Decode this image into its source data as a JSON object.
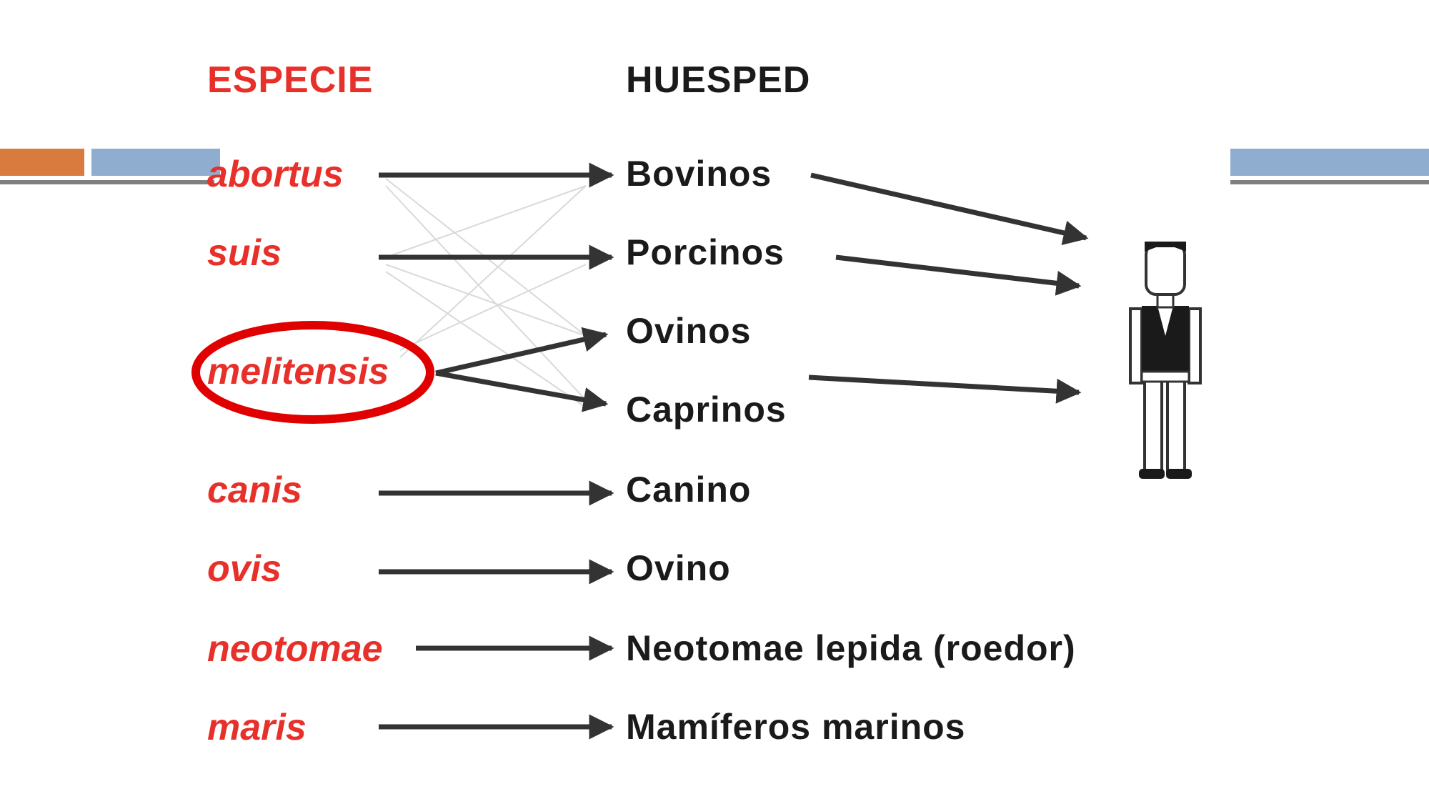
{
  "headers": {
    "species": "ESPECIE",
    "host": "HUESPED"
  },
  "species": [
    "abortus",
    "suis",
    "melitensis",
    "canis",
    "ovis",
    "neotomae",
    "maris"
  ],
  "hosts": [
    "Bovinos",
    "Porcinos",
    "Ovinos",
    "Caprinos",
    "Canino",
    "Ovino",
    "Neotomae lepida (roedor)",
    "Mamíferos marinos"
  ],
  "highlighted_species": "melitensis",
  "colors": {
    "species_text": "#e8302a",
    "host_text": "#1a1a1a",
    "arrow": "#333333",
    "highlight_ring": "#e00000",
    "bar_orange": "#d97a3e",
    "bar_blue": "#8fadcf"
  },
  "icons": {
    "human": "human-figure-icon"
  }
}
